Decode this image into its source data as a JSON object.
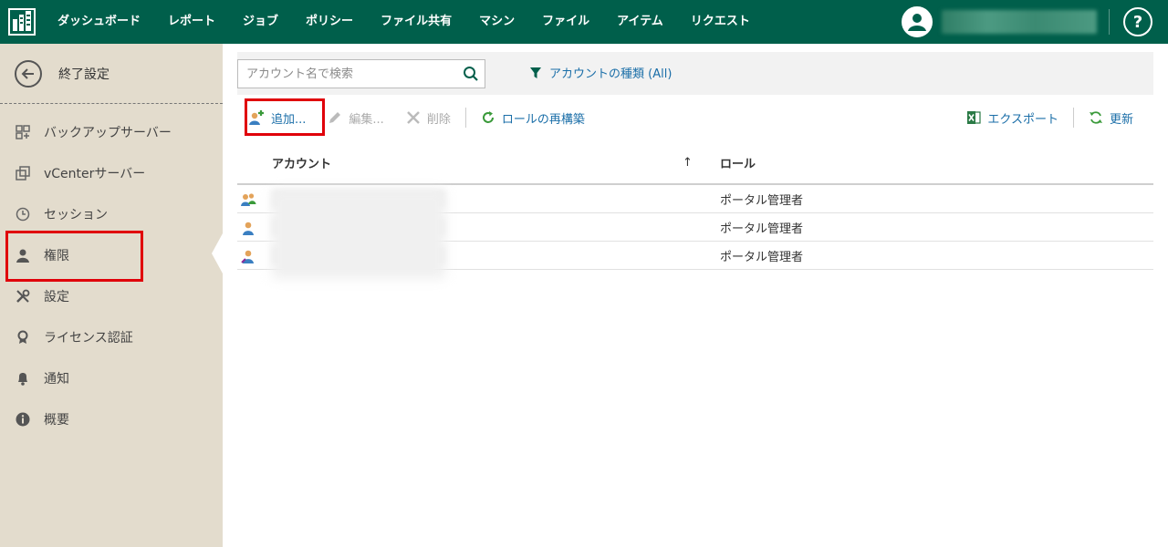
{
  "topbar": {
    "nav": [
      "ダッシュボード",
      "レポート",
      "ジョブ",
      "ポリシー",
      "ファイル共有",
      "マシン",
      "ファイル",
      "アイテム",
      "リクエスト"
    ],
    "help": "?"
  },
  "sidebar": {
    "back_label": "終了設定",
    "items": [
      {
        "label": "バックアップサーバー",
        "icon": "server-icon"
      },
      {
        "label": "vCenterサーバー",
        "icon": "vcenter-icon"
      },
      {
        "label": "セッション",
        "icon": "clock-icon"
      },
      {
        "label": "権限",
        "icon": "user-icon"
      },
      {
        "label": "設定",
        "icon": "tools-icon"
      },
      {
        "label": "ライセンス認証",
        "icon": "license-icon"
      },
      {
        "label": "通知",
        "icon": "bell-icon"
      },
      {
        "label": "概要",
        "icon": "info-icon"
      }
    ]
  },
  "search": {
    "placeholder": "アカウント名で検索",
    "filter_label": "アカウントの種類 (All)"
  },
  "toolbar": {
    "add": "追加...",
    "edit": "編集...",
    "delete": "削除",
    "rebuild": "ロールの再構築",
    "export": "エクスポート",
    "refresh": "更新"
  },
  "grid": {
    "col_account": "アカウント",
    "sort_indicator": "↑",
    "col_role": "ロール",
    "rows": [
      {
        "type": "group",
        "role": "ポータル管理者"
      },
      {
        "type": "user",
        "role": "ポータル管理者"
      },
      {
        "type": "user-admin",
        "role": "ポータル管理者"
      }
    ]
  },
  "colors": {
    "topbar": "#005f4b",
    "sidebar": "#e3dccd",
    "link": "#1a6ea8",
    "highlight": "#e0000a",
    "green_icon": "#3a9a3a"
  }
}
